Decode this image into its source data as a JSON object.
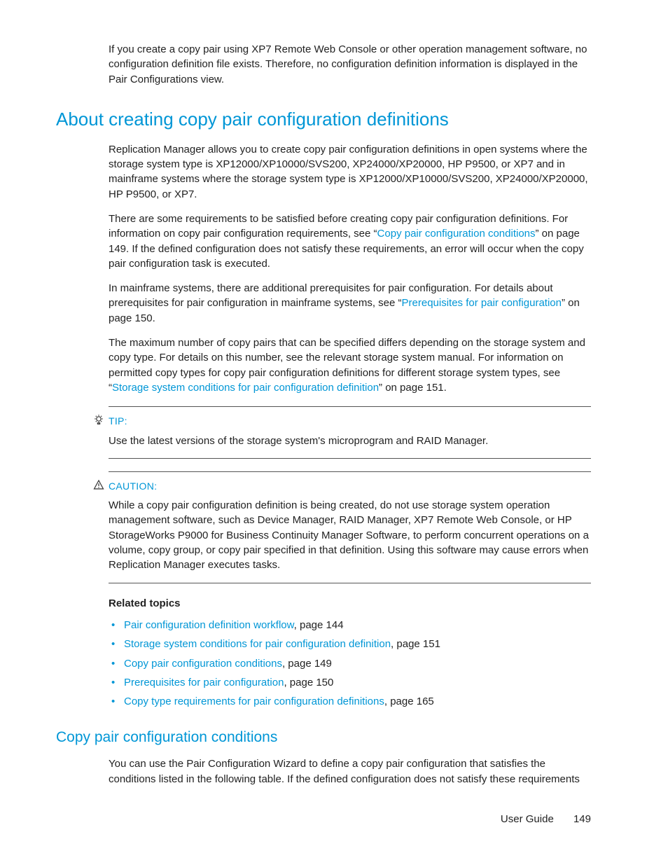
{
  "intro_para": "If you create a copy pair using XP7 Remote Web Console or other operation management software, no configuration definition file exists. Therefore, no configuration definition information is displayed in the Pair Configurations view.",
  "section1": {
    "title": "About creating copy pair configuration definitions",
    "p1": "Replication Manager allows you to create copy pair configuration definitions in open systems where the storage system type is XP12000/XP10000/SVS200, XP24000/XP20000, HP P9500, or XP7 and in mainframe systems where the storage system type is XP12000/XP10000/SVS200, XP24000/XP20000, HP P9500, or XP7.",
    "p2_a": "There are some requirements to be satisfied before creating copy pair configuration definitions. For information on copy pair configuration requirements, see “",
    "p2_link": "Copy pair configuration conditions",
    "p2_b": "” on page 149. If the defined configuration does not satisfy these requirements, an error will occur when the copy pair configuration task is executed.",
    "p3_a": "In mainframe systems, there are additional prerequisites for pair configuration. For details about prerequisites for pair configuration in mainframe systems, see “",
    "p3_link": "Prerequisites for pair configuration",
    "p3_b": "” on page 150.",
    "p4_a": "The maximum number of copy pairs that can be specified differs depending on the storage system and copy type. For details on this number, see the relevant storage system manual. For information on permitted copy types for copy pair configuration definitions for different storage system types, see “",
    "p4_link": "Storage system conditions for pair configuration definition",
    "p4_b": "” on page 151."
  },
  "tip": {
    "label": "TIP:",
    "body": "Use the latest versions of the storage system's microprogram and RAID Manager."
  },
  "caution": {
    "label": "CAUTION:",
    "body": "While a copy pair configuration definition is being created, do not use storage system operation management software, such as Device Manager, RAID Manager, XP7 Remote Web Console, or HP StorageWorks P9000 for Business Continuity Manager Software, to perform concurrent operations on a volume, copy group, or copy pair specified in that definition. Using this software may cause errors when Replication Manager executes tasks."
  },
  "related": {
    "heading": "Related topics",
    "items": [
      {
        "link": "Pair configuration definition workflow",
        "suffix": ", page 144"
      },
      {
        "link": "Storage system conditions for pair configuration definition",
        "suffix": ", page 151"
      },
      {
        "link": "Copy pair configuration conditions",
        "suffix": ", page 149"
      },
      {
        "link": "Prerequisites for pair configuration",
        "suffix": ", page 150"
      },
      {
        "link": "Copy type requirements for pair configuration definitions",
        "suffix": ", page 165"
      }
    ]
  },
  "section2": {
    "title": "Copy pair configuration conditions",
    "p1": "You can use the Pair Configuration Wizard to define a copy pair configuration that satisfies the conditions listed in the following table. If the defined configuration does not satisfy these requirements"
  },
  "footer": {
    "label": "User Guide",
    "page": "149"
  }
}
